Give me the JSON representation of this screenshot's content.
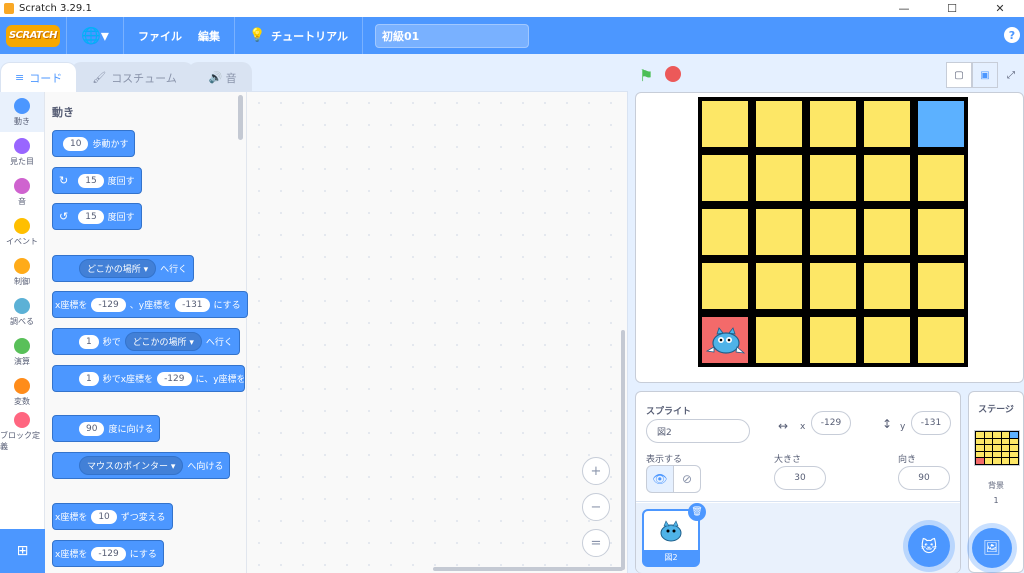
{
  "window": {
    "title": "Scratch 3.29.1",
    "minimize": "—",
    "maximize": "☐",
    "close": "✕"
  },
  "menubar": {
    "logo": "SCRATCH",
    "globe": "🌐▾",
    "file": "ファイル",
    "edit": "編集",
    "tutorial": "チュートリアル",
    "project_title": "初級01",
    "help": "?"
  },
  "tabs": [
    {
      "label": "コード"
    },
    {
      "label": "コスチューム"
    },
    {
      "label": "音"
    }
  ],
  "categories": [
    {
      "label": "動き",
      "color": "#4c97ff"
    },
    {
      "label": "見た目",
      "color": "#9966ff"
    },
    {
      "label": "音",
      "color": "#cf63cf"
    },
    {
      "label": "イベント",
      "color": "#ffbf00"
    },
    {
      "label": "制御",
      "color": "#ffab19"
    },
    {
      "label": "調べる",
      "color": "#5cb1d6"
    },
    {
      "label": "演算",
      "color": "#59c059"
    },
    {
      "label": "変数",
      "color": "#ff8c1a"
    },
    {
      "label": "ブロック定義",
      "color": "#ff6680"
    }
  ],
  "palette": {
    "section": "動き",
    "blocks": {
      "move": {
        "value": "10",
        "text": "歩動かす"
      },
      "turn_right": {
        "icon": "↻",
        "value": "15",
        "text": "度回す"
      },
      "turn_left": {
        "icon": "↺",
        "value": "15",
        "text": "度回す"
      },
      "goto": {
        "dropdown": "どこかの場所 ▾",
        "text": "へ行く"
      },
      "goto_xy": {
        "pre": "x座標を",
        "x": "-129",
        "mid": "、y座標を",
        "y": "-131",
        "post": "にする"
      },
      "glide": {
        "value": "1",
        "mid": "秒で",
        "dropdown": "どこかの場所 ▾",
        "post": "へ行く"
      },
      "glide_xy": {
        "value": "1",
        "mid": "秒でx座標を",
        "x": "-129",
        "post": "に、y座標を"
      },
      "point_dir": {
        "value": "90",
        "text": "度に向ける"
      },
      "point_towards": {
        "dropdown": "マウスのポインター ▾",
        "text": "へ向ける"
      },
      "change_x": {
        "pre": "x座標を",
        "value": "10",
        "post": "ずつ変える"
      },
      "set_x": {
        "pre": "x座標を",
        "value": "-129",
        "post": "にする"
      }
    }
  },
  "zoom": {
    "in": "+",
    "out": "−",
    "reset": "="
  },
  "stage": {
    "flag": "⚑",
    "small_mode": "▢",
    "normal_mode": "▣",
    "fullscreen": "⤢"
  },
  "sprite_info": {
    "sprite_label": "スプライト",
    "sprite_name": "図2",
    "x_label": "x",
    "x_value": "-129",
    "y_label": "y",
    "y_value": "-131",
    "show_label": "表示する",
    "size_label": "大きさ",
    "size_value": "30",
    "direction_label": "向き",
    "direction_value": "90",
    "eye_icon": "👁",
    "hide_icon": "⊘"
  },
  "sprite_list": [
    {
      "name": "図2"
    }
  ],
  "stage_pane": {
    "label": "ステージ",
    "backdrop_label": "背景",
    "backdrop_count": "1"
  },
  "colors": {
    "accent": "#4c97ff",
    "cell_yellow": "#fde766",
    "cell_blue": "#5cb1ff",
    "sprite_red": "#f36a6a"
  }
}
